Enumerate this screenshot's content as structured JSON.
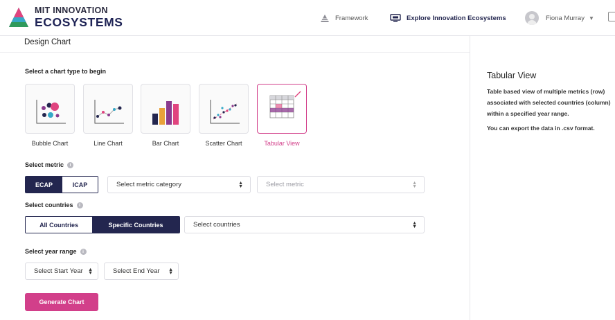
{
  "header": {
    "logo_line1": "MIT INNOVATION",
    "logo_line2": "ECOSYSTEMS",
    "nav_framework": "Framework",
    "nav_explore": "Explore Innovation Ecosystems",
    "user_name": "Fiona Murray",
    "icons": [
      "logo-triangle-icon",
      "framework-pyramid-icon",
      "explore-screen-icon",
      "avatar",
      "chevron-down-icon",
      "expand-icon"
    ]
  },
  "page": {
    "title": "Design Chart"
  },
  "chart_type": {
    "heading": "Select a chart type to begin",
    "options": [
      {
        "label": "Bubble Chart",
        "selected": false
      },
      {
        "label": "Line Chart",
        "selected": false
      },
      {
        "label": "Bar Chart",
        "selected": false
      },
      {
        "label": "Scatter Chart",
        "selected": false
      },
      {
        "label": "Tabular View",
        "selected": true
      }
    ]
  },
  "metric": {
    "heading": "Select metric",
    "toggle": [
      {
        "label": "ECAP",
        "active": true
      },
      {
        "label": "ICAP",
        "active": false
      }
    ],
    "category_placeholder": "Select metric category",
    "metric_placeholder": "Select metric"
  },
  "countries": {
    "heading": "Select countries",
    "toggle": [
      {
        "label": "All Countries",
        "active": false
      },
      {
        "label": "Specific Countries",
        "active": true
      }
    ],
    "placeholder": "Select countries"
  },
  "year_range": {
    "heading": "Select year range",
    "start_placeholder": "Select Start Year",
    "end_placeholder": "Select End Year"
  },
  "actions": {
    "generate_label": "Generate Chart"
  },
  "side_panel": {
    "title": "Tabular View",
    "description": "Table based view of multiple metrics (row) associated with selected countries (column) within a specified year range.",
    "note": "You can export the data in .csv format."
  },
  "colors": {
    "navy": "#23264f",
    "accent_pink": "#d23f8a",
    "bar_orange": "#e8a13a",
    "bar_purple": "#8a3a8e"
  }
}
